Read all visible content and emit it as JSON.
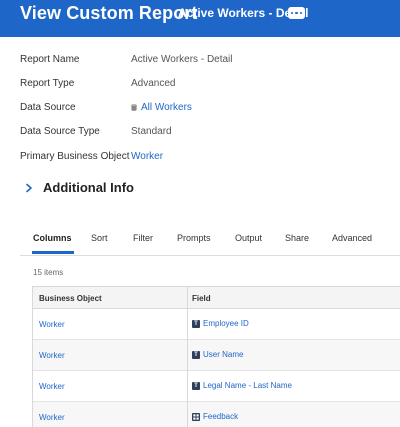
{
  "header": {
    "title": "View Custom Report",
    "subtitle": "Active Workers - Detail",
    "related_actions_icon": "ellipsis-icon"
  },
  "details": {
    "report_name_label": "Report Name",
    "report_name_value": "Active Workers - Detail",
    "report_type_label": "Report Type",
    "report_type_value": "Advanced",
    "data_source_label": "Data Source",
    "data_source_value": "All Workers",
    "data_source_icon": "data-source-icon",
    "data_source_type_label": "Data Source Type",
    "data_source_type_value": "Standard",
    "primary_bo_label": "Primary Business Object",
    "primary_bo_value": "Worker"
  },
  "additional_info": {
    "title": "Additional Info",
    "icon": "chevron-right-icon"
  },
  "tabs": [
    "Columns",
    "Sort",
    "Filter",
    "Prompts",
    "Output",
    "Share",
    "Advanced"
  ],
  "active_tab": "Columns",
  "table": {
    "count_label": "15 items",
    "headers": [
      "Business Object",
      "Field"
    ],
    "rows": [
      {
        "business_object": "Worker",
        "field": "Employee ID",
        "field_type": "text"
      },
      {
        "business_object": "Worker",
        "field": "User Name",
        "field_type": "text"
      },
      {
        "business_object": "Worker",
        "field": "Legal Name - Last Name",
        "field_type": "text"
      },
      {
        "business_object": "Worker",
        "field": "Feedback",
        "field_type": "multi-instance"
      }
    ]
  },
  "colors": {
    "brand": "#1f66c9",
    "link": "#1f66c9",
    "icon_dark": "#2e3e5c"
  }
}
